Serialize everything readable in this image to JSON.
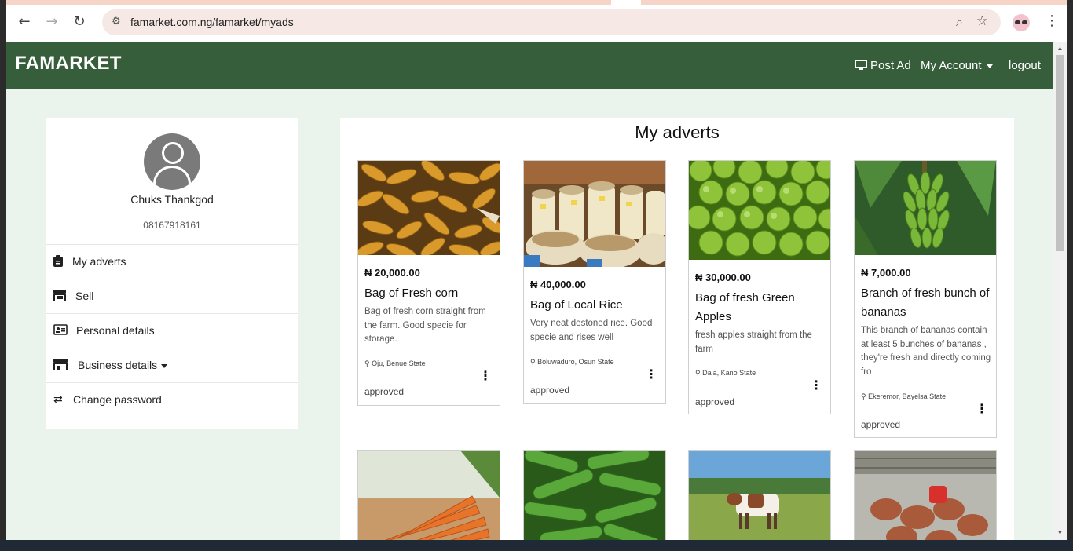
{
  "browser": {
    "url": "famarket.com.ng/famarket/myads"
  },
  "navbar": {
    "brand": "FAMARKET",
    "post_ad": "Post Ad",
    "my_account": "My Account",
    "logout": "logout"
  },
  "profile": {
    "name": "Chuks Thankgod",
    "phone": "08167918161"
  },
  "sidebar": {
    "items": [
      {
        "label": "My adverts",
        "icon": "clipboard-icon"
      },
      {
        "label": "Sell",
        "icon": "shop-icon"
      },
      {
        "label": "Personal details",
        "icon": "id-card-icon"
      },
      {
        "label": "Business details",
        "icon": "store-icon"
      },
      {
        "label": "Change password",
        "icon": "swap-arrows-icon"
      }
    ]
  },
  "main": {
    "title": "My adverts",
    "ads": [
      {
        "price": "₦ 20,000.00",
        "title": "Bag of Fresh corn",
        "description": "Bag of fresh corn straight from the farm. Good specie for storage.",
        "location": "Oju, Benue State",
        "status": "approved"
      },
      {
        "price": "₦ 40,000.00",
        "title": "Bag of Local Rice",
        "description": "Very neat destoned rice. Good specie and rises well",
        "location": "Boluwaduro, Osun State",
        "status": "approved"
      },
      {
        "price": "₦ 30,000.00",
        "title": "Bag of fresh Green Apples",
        "description": "fresh apples straight from the farm",
        "location": "Dala, Kano State",
        "status": "approved"
      },
      {
        "price": "₦ 7,000.00",
        "title": "Branch of fresh bunch of bananas",
        "description": "This branch of bananas contain at least 5 bunches of bananas , they're fresh and directly coming fro",
        "location": "Ekeremor, Bayelsa State",
        "status": "approved"
      }
    ]
  },
  "colors": {
    "navbar": "#365e3a",
    "page_bg": "#eaf4ec"
  }
}
